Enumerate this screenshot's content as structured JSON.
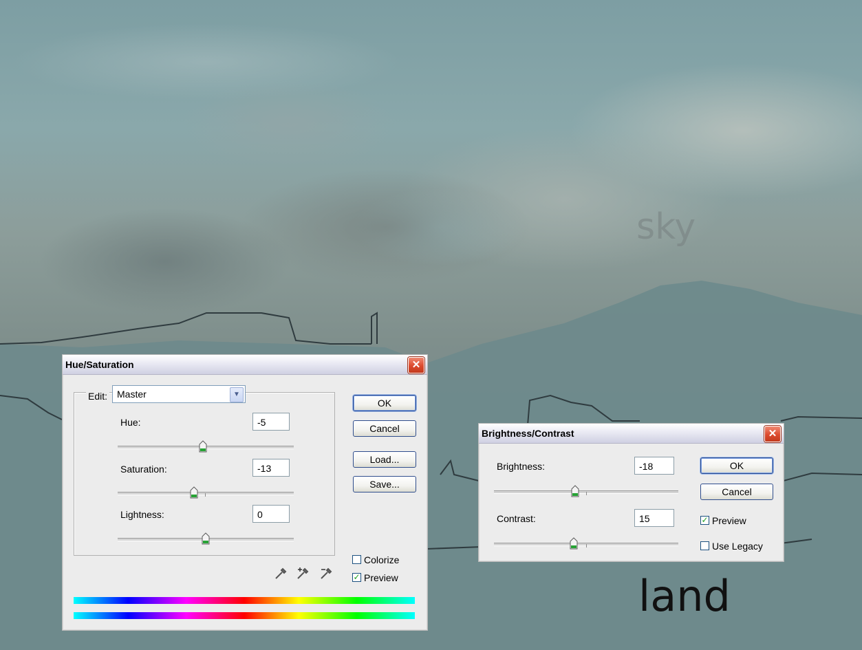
{
  "canvas": {
    "layer_labels": {
      "sky": "sky",
      "land": "land"
    },
    "colors": {
      "land": "#6e8a8c",
      "outline": "#2f3b3f"
    }
  },
  "hue_saturation": {
    "title": "Hue/Saturation",
    "close_glyph": "✕",
    "edit_label": "Edit:",
    "edit_value": "Master",
    "edit_arrow": "▼",
    "sliders": [
      {
        "label": "Hue:",
        "value": "-5",
        "min": -180,
        "max": 180,
        "numeric": -5
      },
      {
        "label": "Saturation:",
        "value": "-13",
        "min": -100,
        "max": 100,
        "numeric": -13
      },
      {
        "label": "Lightness:",
        "value": "0",
        "min": -100,
        "max": 100,
        "numeric": 0
      }
    ],
    "buttons": {
      "ok": "OK",
      "cancel": "Cancel",
      "load": "Load...",
      "save": "Save..."
    },
    "colorize": {
      "label": "Colorize",
      "checked": false
    },
    "preview": {
      "label": "Preview",
      "checked": true
    },
    "icons": [
      "eyedropper-icon",
      "eyedropper-plus-icon",
      "eyedropper-minus-icon"
    ]
  },
  "brightness_contrast": {
    "title": "Brightness/Contrast",
    "close_glyph": "✕",
    "sliders": [
      {
        "label": "Brightness:",
        "value": "-18",
        "min": -150,
        "max": 150,
        "numeric": -18
      },
      {
        "label": "Contrast:",
        "value": "15",
        "min": -50,
        "max": 100,
        "numeric": 15
      }
    ],
    "buttons": {
      "ok": "OK",
      "cancel": "Cancel"
    },
    "preview": {
      "label": "Preview",
      "checked": true
    },
    "use_legacy": {
      "label": "Use Legacy",
      "checked": false
    }
  }
}
